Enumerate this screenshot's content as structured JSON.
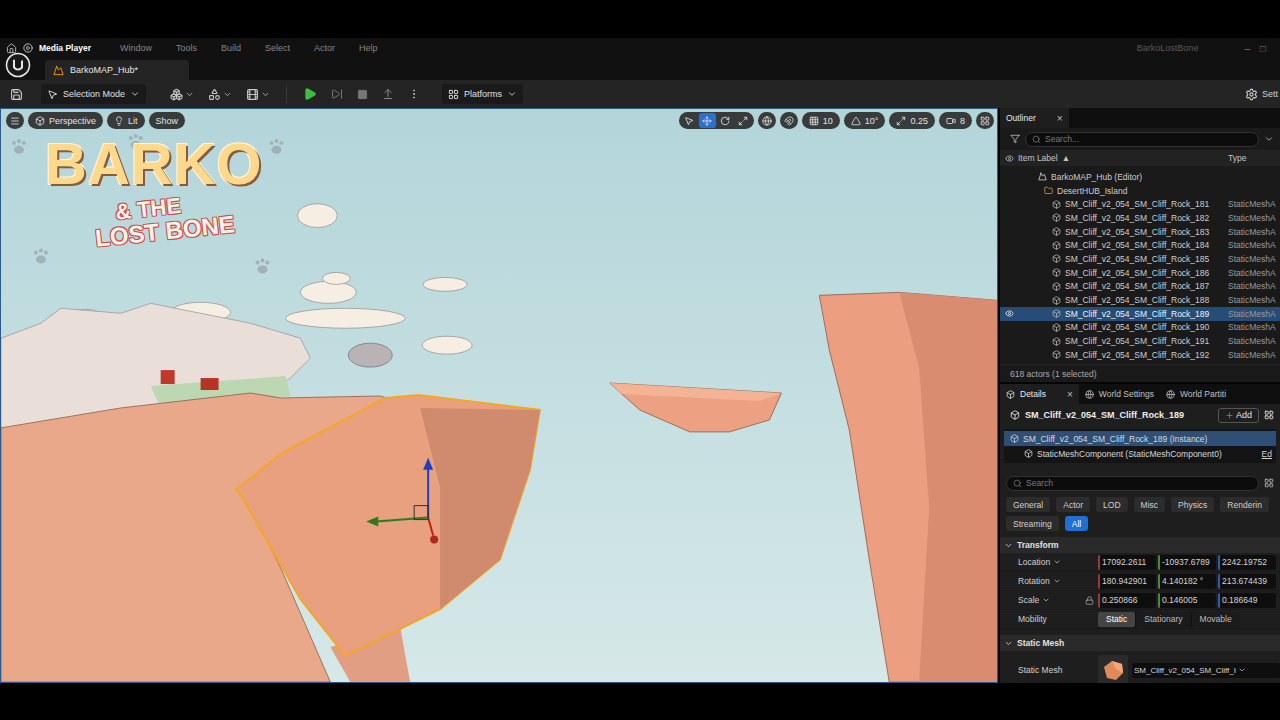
{
  "menubar": {
    "tooltip": "Media Player",
    "items": [
      "Window",
      "Tools",
      "Build",
      "Select",
      "Actor",
      "Help"
    ],
    "project": "BarkoLostBone",
    "controls": [
      "–",
      "□"
    ]
  },
  "document_tab": {
    "label": "BarkoMAP_Hub*",
    "selected": true
  },
  "toolbar": {
    "mode": "Selection Mode",
    "platforms": "Platforms",
    "settings": "Sett"
  },
  "viewport": {
    "view_menu": [
      {
        "label": "Perspective",
        "kind": "perspective"
      },
      {
        "label": "Lit",
        "kind": "lit"
      },
      {
        "label": "Show",
        "kind": "show"
      }
    ],
    "tools": [
      {
        "kind": "select",
        "selected": false
      },
      {
        "kind": "translate",
        "selected": true
      },
      {
        "kind": "rotate",
        "selected": false
      },
      {
        "kind": "scale",
        "selected": false
      }
    ],
    "snaps": [
      {
        "kind": "grid",
        "value": "10"
      },
      {
        "kind": "angle",
        "value": "10°"
      },
      {
        "kind": "scale",
        "value": "0.25"
      },
      {
        "kind": "camera",
        "value": "8"
      }
    ],
    "logo": {
      "title": "BARKO",
      "lines": [
        "& THE",
        "LOST BONE"
      ]
    },
    "selection_outline": true
  },
  "outliner": {
    "title": "Outliner",
    "close": "×",
    "search_placeholder": "Search...",
    "columns": {
      "label": "Item Label",
      "sort": "▲",
      "type": "Type"
    },
    "rows": [
      {
        "label": "BarkoMAP_Hub (Editor)",
        "type": "",
        "kind": "world",
        "selected": false,
        "eye": false
      },
      {
        "label": "DesertHUB_Island",
        "type": "",
        "kind": "folder",
        "selected": false,
        "eye": false
      },
      {
        "label": "SM_Cliff_v2_054_SM_Cliff_Rock_181",
        "type": "StaticMeshA",
        "kind": "actor",
        "selected": false,
        "eye": false
      },
      {
        "label": "SM_Cliff_v2_054_SM_Cliff_Rock_182",
        "type": "StaticMeshA",
        "kind": "actor",
        "selected": false,
        "eye": false
      },
      {
        "label": "SM_Cliff_v2_054_SM_Cliff_Rock_183",
        "type": "StaticMeshA",
        "kind": "actor",
        "selected": false,
        "eye": false
      },
      {
        "label": "SM_Cliff_v2_054_SM_Cliff_Rock_184",
        "type": "StaticMeshA",
        "kind": "actor",
        "selected": false,
        "eye": false
      },
      {
        "label": "SM_Cliff_v2_054_SM_Cliff_Rock_185",
        "type": "StaticMeshA",
        "kind": "actor",
        "selected": false,
        "eye": false
      },
      {
        "label": "SM_Cliff_v2_054_SM_Cliff_Rock_186",
        "type": "StaticMeshA",
        "kind": "actor",
        "selected": false,
        "eye": false
      },
      {
        "label": "SM_Cliff_v2_054_SM_Cliff_Rock_187",
        "type": "StaticMeshA",
        "kind": "actor",
        "selected": false,
        "eye": false
      },
      {
        "label": "SM_Cliff_v2_054_SM_Cliff_Rock_188",
        "type": "StaticMeshA",
        "kind": "actor",
        "selected": false,
        "eye": false
      },
      {
        "label": "SM_Cliff_v2_054_SM_Cliff_Rock_189",
        "type": "StaticMeshA",
        "kind": "actor",
        "selected": true,
        "eye": true
      },
      {
        "label": "SM_Cliff_v2_054_SM_Cliff_Rock_190",
        "type": "StaticMeshA",
        "kind": "actor",
        "selected": false,
        "eye": false
      },
      {
        "label": "SM_Cliff_v2_054_SM_Cliff_Rock_191",
        "type": "StaticMeshA",
        "kind": "actor",
        "selected": false,
        "eye": false
      },
      {
        "label": "SM_Cliff_v2_054_SM_Cliff_Rock_192",
        "type": "StaticMeshA",
        "kind": "actor",
        "selected": false,
        "eye": false
      }
    ],
    "footer": "618 actors (1 selected)"
  },
  "details": {
    "tabs": [
      {
        "label": "Details",
        "selected": true,
        "closable": true
      },
      {
        "label": "World Settings",
        "selected": false,
        "closable": false
      },
      {
        "label": "World Partiti",
        "selected": false,
        "closable": false
      }
    ],
    "close": "×",
    "actor": "SM_Cliff_v2_054_SM_Cliff_Rock_189",
    "add": "Add",
    "components": [
      {
        "label": "SM_Cliff_v2_054_SM_Cliff_Rock_189 (Instance)",
        "kind": "root",
        "selected": true,
        "action": ""
      },
      {
        "label": "StaticMeshComponent (StaticMeshComponent0)",
        "kind": "child",
        "selected": false,
        "action": "Ed"
      }
    ],
    "search_placeholder": "Search",
    "filters": [
      {
        "label": "General",
        "selected": false
      },
      {
        "label": "Actor",
        "selected": false
      },
      {
        "label": "LOD",
        "selected": false
      },
      {
        "label": "Misc",
        "selected": false
      },
      {
        "label": "Physics",
        "selected": false
      },
      {
        "label": "Renderin",
        "selected": false
      },
      {
        "label": "Streaming",
        "selected": false
      },
      {
        "label": "All",
        "selected": true
      }
    ],
    "transform": {
      "title": "Transform",
      "rows": [
        {
          "label": "Location",
          "values": [
            "17092.2611",
            "-10937.6789",
            "2242.19752"
          ],
          "locked": false
        },
        {
          "label": "Rotation",
          "values": [
            "180.942901",
            "4.140182 °",
            "213.674439"
          ],
          "locked": false
        },
        {
          "label": "Scale",
          "values": [
            "0.250866",
            "0.146005",
            "0.186649"
          ],
          "locked": true
        }
      ],
      "mobility": {
        "label": "Mobility",
        "options": [
          {
            "label": "Static",
            "selected": true
          },
          {
            "label": "Stationary",
            "selected": false
          },
          {
            "label": "Movable",
            "selected": false
          }
        ]
      }
    },
    "static_mesh": {
      "title": "Static Mesh",
      "label": "Static Mesh",
      "value": "SM_Cliff_v2_054_SM_Cliff_I"
    }
  }
}
